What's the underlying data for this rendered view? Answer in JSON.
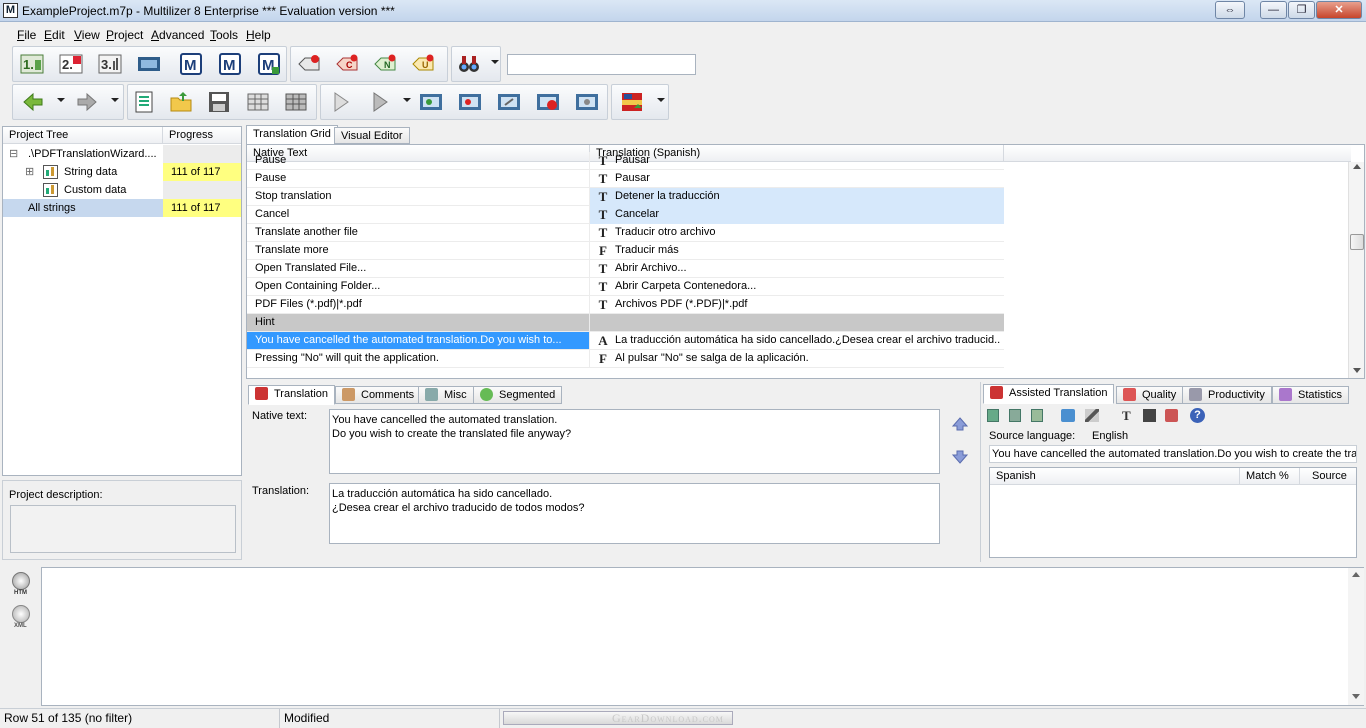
{
  "window": {
    "title": "ExampleProject.m7p - Multilizer 8 Enterprise *** Evaluation version ***",
    "app_icon": "M",
    "buttons": [
      "⇔",
      "—",
      "❐",
      "✕"
    ]
  },
  "menu": [
    "File",
    "Edit",
    "View",
    "Project",
    "Advanced",
    "Tools",
    "Help"
  ],
  "toolbar1": {
    "icons": [
      "step-1-icon",
      "step-2-icon",
      "step-3-icon",
      "film-icon",
      "multilizer-m-icon",
      "multilizer-m-icon",
      "multilizer-m-icon",
      "tag-red-icon",
      "tag-c-icon",
      "tag-n-icon",
      "tag-u-icon",
      "binoculars-icon"
    ],
    "search_value": ""
  },
  "toolbar2": {
    "icons": [
      "back-arrow-icon",
      "forward-arrow-icon",
      "document-icon",
      "open-folder-icon",
      "save-icon",
      "grid-icon",
      "grid-dark-icon",
      "play-icon",
      "play-icon",
      "film-frame-icon",
      "film-frame-icon",
      "film-frame-icon",
      "film-stop-icon",
      "film-frame-icon",
      "flag-icon"
    ]
  },
  "project_tree": {
    "headers": {
      "name": "Project Tree",
      "progress": "Progress"
    },
    "rows": [
      {
        "label": ".\\PDFTranslationWizard....",
        "progress": "",
        "expander": "⊟"
      },
      {
        "label": "String data",
        "progress": "111 of 117",
        "expander": "⊞"
      },
      {
        "label": "Custom data",
        "progress": "",
        "expander": ""
      },
      {
        "label": "All strings",
        "progress": "111 of 117",
        "expander": ""
      }
    ],
    "description_label": "Project description:"
  },
  "grid": {
    "tabs": [
      "Translation Grid",
      "Visual Editor"
    ],
    "headers": {
      "native": "Native Text",
      "translation": "Translation (Spanish)"
    },
    "rows": [
      {
        "native": "Pause",
        "status": "T",
        "translation": "Pausar"
      },
      {
        "native": "Pause",
        "status": "T",
        "translation": "Pausar"
      },
      {
        "native": "Stop translation",
        "status": "T",
        "translation": "Detener la traducción"
      },
      {
        "native": "Cancel",
        "status": "T",
        "translation": "Cancelar"
      },
      {
        "native": "Translate another file",
        "status": "T",
        "translation": "Traducir otro archivo"
      },
      {
        "native": "Translate more",
        "status": "F",
        "translation": "Traducir más"
      },
      {
        "native": "Open Translated File...",
        "status": "T",
        "translation": "Abrir Archivo..."
      },
      {
        "native": "Open Containing Folder...",
        "status": "T",
        "translation": "Abrir Carpeta Contenedora..."
      },
      {
        "native": "PDF Files (*.pdf)|*.pdf",
        "status": "T",
        "translation": "Archivos PDF (*.PDF)|*.pdf"
      },
      {
        "native": "Hint",
        "status": "",
        "translation": ""
      },
      {
        "native": "You have cancelled the automated translation.Do you wish to...",
        "status": "A",
        "translation": "La traducción automática ha sido cancellado.¿Desea crear el archivo traducid..."
      },
      {
        "native": "Pressing \"No\" will quit the application.",
        "status": "F",
        "translation": "Al pulsar \"No\" se salga de la aplicación."
      }
    ]
  },
  "editor": {
    "tabs": [
      "Translation",
      "Comments",
      "Misc",
      "Segmented"
    ],
    "native_label": "Native text:",
    "native_text": "You have cancelled the automated translation.\nDo you wish to create the translated file anyway?",
    "translation_label": "Translation:",
    "translation_text": "La traducción automática ha sido cancellado.\n¿Desea crear el archivo traducido de todos modos?"
  },
  "assist": {
    "tabs": [
      "Assisted Translation",
      "Quality",
      "Productivity",
      "Statistics"
    ],
    "source_language_label": "Source language:",
    "source_language_value": "English",
    "source_text": "You have cancelled the automated translation.Do you wish to create the tra",
    "columns": [
      "Spanish",
      "Match %",
      "Source"
    ]
  },
  "preview": {
    "icons": [
      {
        "name": "htm-icon",
        "caption": "HTM"
      },
      {
        "name": "xml-icon",
        "caption": "XML"
      }
    ]
  },
  "status": {
    "row_info": "Row 51 of 135 (no filter)",
    "state": "Modified",
    "progress_fraction": 0,
    "watermark": "GearDownload.com"
  }
}
